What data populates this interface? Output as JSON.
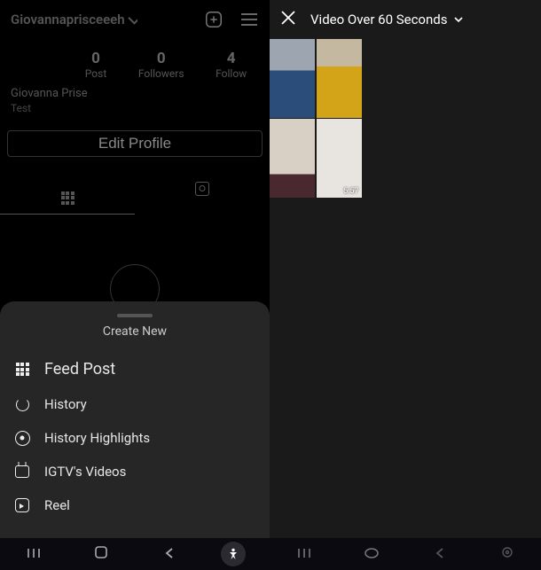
{
  "profile": {
    "username": "Giovannaprisceeeh",
    "display_name": "Giovanna Prise",
    "bio": "Test",
    "stats": [
      {
        "count": "0",
        "label": "Post"
      },
      {
        "count": "0",
        "label": "Followers"
      },
      {
        "count": "4",
        "label": "Follow"
      }
    ],
    "edit_label": "Edit Profile"
  },
  "create_sheet": {
    "title": "Create New",
    "items": [
      {
        "label": "Feed Post"
      },
      {
        "label": "History"
      },
      {
        "label": "History Highlights"
      },
      {
        "label": "IGTV's Videos"
      },
      {
        "label": "Reel"
      }
    ]
  },
  "picker": {
    "filter_label": "Video Over 60 Seconds",
    "thumbnails": [
      {
        "duration": ""
      },
      {
        "duration": ""
      },
      {
        "duration": ""
      },
      {
        "duration": "5:57"
      }
    ]
  }
}
